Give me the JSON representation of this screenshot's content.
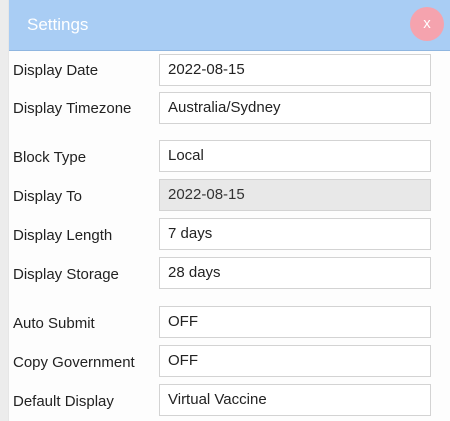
{
  "dialog": {
    "title": "Settings",
    "close_label": "x"
  },
  "fields": [
    {
      "label": "Display Date",
      "value": "2022-08-15"
    },
    {
      "label": "Display Timezone",
      "value": "Australia/Sydney"
    },
    {
      "label": "Block Type",
      "value": "Local"
    },
    {
      "label": "Display To",
      "value": "2022-08-15"
    },
    {
      "label": "Display Length",
      "value": "7 days"
    },
    {
      "label": "Display Storage",
      "value": "28 days"
    },
    {
      "label": "Auto Submit",
      "value": "OFF"
    },
    {
      "label": "Copy Government",
      "value": "OFF"
    },
    {
      "label": "Default Display",
      "value": "Virtual Vaccine"
    }
  ],
  "colors": {
    "header": "#a9cdf4",
    "close_button": "#f5a3ae",
    "disabled_field": "#e8e8e8"
  }
}
